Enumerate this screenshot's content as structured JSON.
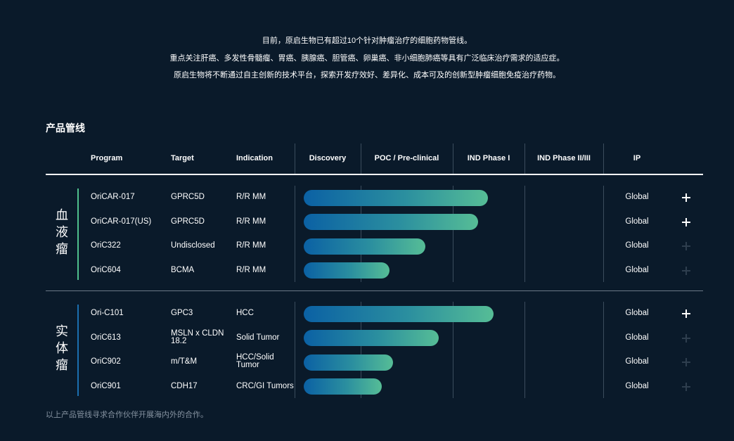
{
  "intro": {
    "line1": "目前，原启生物已有超过10个针对肿瘤治疗的细胞药物管线。",
    "line2": "重点关注肝癌、多发性骨髓瘤、胃癌、胰腺癌、胆管癌、卵巢癌、非小细胞肺癌等具有广泛临床治疗需求的适应症。",
    "line3": "原启生物将不断通过自主创新的技术平台，探索开发疗效好、差异化、成本可及的创新型肿瘤细胞免疫治疗药物。"
  },
  "section_title": "产品管线",
  "headers": {
    "program": "Program",
    "target": "Target",
    "indication": "Indication",
    "discovery": "Discovery",
    "poc": "POC / Pre-clinical",
    "ind1": "IND Phase I",
    "ind23": "IND Phase II/III",
    "ip": "IP"
  },
  "groups": [
    {
      "label_chars": [
        "血",
        "液",
        "瘤"
      ],
      "accent": "#4fc08d",
      "rows": [
        {
          "program": "OriCAR-017",
          "target": "GPRC5D",
          "indication": "R/R MM",
          "ip": "Global",
          "progress": 0.97,
          "expand_enabled": true
        },
        {
          "program": "OriCAR-017(US)",
          "target": "GPRC5D",
          "indication": "R/R MM",
          "ip": "Global",
          "progress": 0.92,
          "expand_enabled": true
        },
        {
          "program": "OriC322",
          "target": "Undisclosed",
          "indication": "R/R MM",
          "ip": "Global",
          "progress": 0.64,
          "expand_enabled": false
        },
        {
          "program": "OriC604",
          "target": "BCMA",
          "indication": "R/R MM",
          "ip": "Global",
          "progress": 0.45,
          "expand_enabled": false
        }
      ]
    },
    {
      "label_chars": [
        "实",
        "体",
        "瘤"
      ],
      "accent": "#1b6fb0",
      "rows": [
        {
          "program": "Ori-C101",
          "target": "GPC3",
          "indication": "HCC",
          "ip": "Global",
          "progress": 1.0,
          "expand_enabled": true
        },
        {
          "program": "OriC613",
          "target": "MSLN x CLDN 18.2",
          "target_lines": [
            "MSLN x CLDN",
            "18.2"
          ],
          "indication": "Solid Tumor",
          "ip": "Global",
          "progress": 0.71,
          "expand_enabled": false
        },
        {
          "program": "OriC902",
          "target": "m/T&M",
          "indication": "HCC/Solid Tumor",
          "indication_lines": [
            "HCC/Solid",
            "Tumor"
          ],
          "ip": "Global",
          "progress": 0.47,
          "expand_enabled": false
        },
        {
          "program": "OriC901",
          "target": "CDH17",
          "indication": "CRC/GI Tumors",
          "ip": "Global",
          "progress": 0.41,
          "expand_enabled": false
        }
      ]
    }
  ],
  "footnote": "以上产品管线寻求合作伙伴开展海内外的合作。",
  "colors": {
    "background": "#0a1a2a",
    "bar_start": "#0b61a4",
    "bar_end": "#56bd96",
    "plus_active": "#ffffff",
    "plus_inactive": "#2e3e4e"
  }
}
